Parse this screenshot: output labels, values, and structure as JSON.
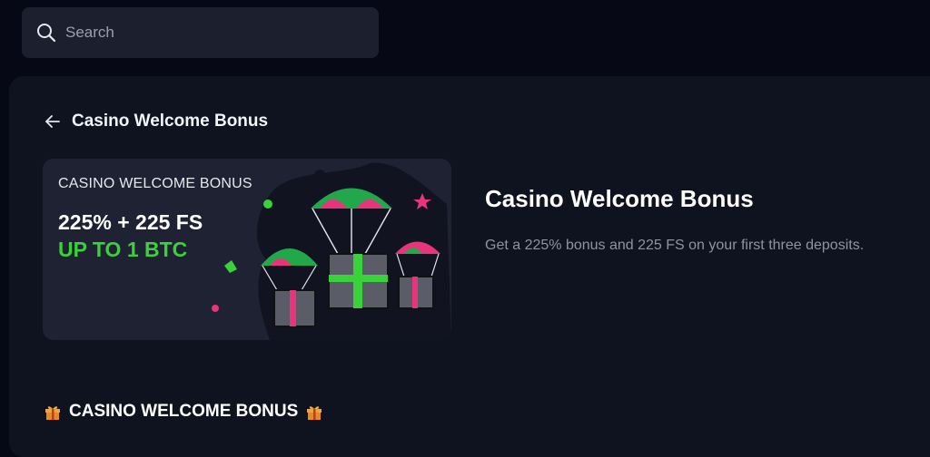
{
  "search": {
    "placeholder": "Search"
  },
  "page": {
    "back_title": "Casino Welcome Bonus"
  },
  "banner": {
    "eyebrow": "CASINO WELCOME BONUS",
    "line1": "225% + 225 FS",
    "line2": "UP TO 1 BTC"
  },
  "info": {
    "title": "Casino Welcome Bonus",
    "description": "Get a 225% bonus and 225 FS on your first three deposits."
  },
  "section": {
    "heading": "CASINO WELCOME BONUS"
  },
  "colors": {
    "background": "#060915",
    "panel": "#0f1320",
    "accent_green": "#3ad23a",
    "accent_pink": "#e8347a"
  }
}
